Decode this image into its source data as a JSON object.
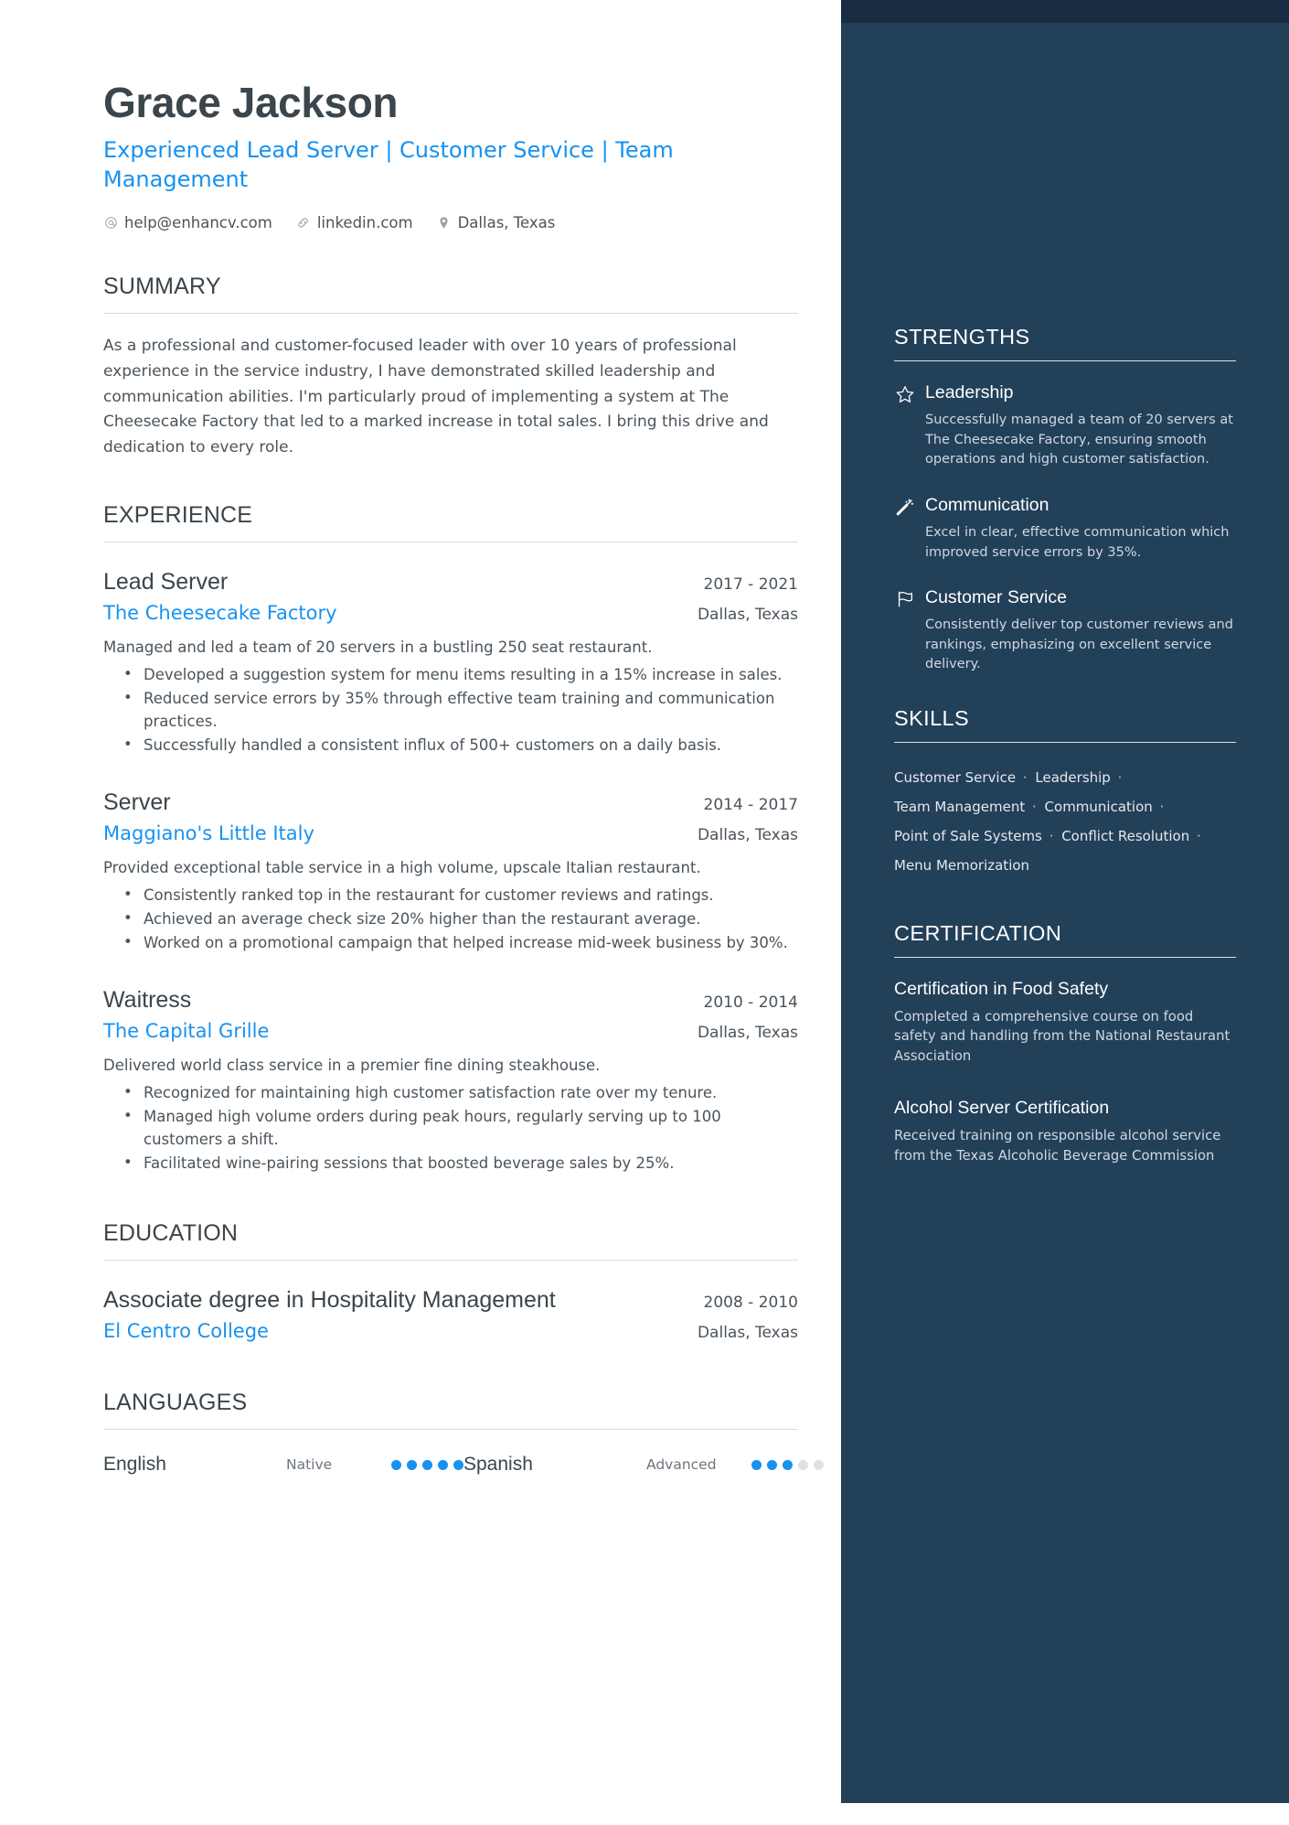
{
  "theme": {
    "accent_blue": "#1792f0",
    "sidebar_bg": "#234059",
    "sidebar_topbar": "#1a2c42",
    "heading_dark": "#3a454c",
    "body_text": "#4a545c",
    "dot_off": "#dfe2e5"
  },
  "header": {
    "name": "Grace Jackson",
    "headline": "Experienced Lead Server | Customer Service | Team Management",
    "contacts": [
      {
        "icon": "at-icon",
        "text": "help@enhancv.com"
      },
      {
        "icon": "link-icon",
        "text": "linkedin.com"
      },
      {
        "icon": "location-pin-icon",
        "text": "Dallas, Texas"
      }
    ]
  },
  "summary": {
    "heading": "SUMMARY",
    "text": "As a professional and customer-focused leader with over 10 years of professional experience in the service industry, I have demonstrated skilled leadership and communication abilities. I'm particularly proud of implementing a system at The Cheesecake Factory that led to a marked increase in total sales. I bring this drive and dedication to every role."
  },
  "experience": {
    "heading": "EXPERIENCE",
    "entries": [
      {
        "role": "Lead Server",
        "organization": "The Cheesecake Factory",
        "date": "2017 - 2021",
        "location": "Dallas, Texas",
        "description": "Managed and led a team of 20 servers in a bustling 250 seat restaurant.",
        "bullets": [
          "Developed a suggestion system for menu items resulting in a 15% increase in sales.",
          "Reduced service errors by 35% through effective team training and communication practices.",
          "Successfully handled a consistent influx of 500+ customers on a daily basis."
        ]
      },
      {
        "role": "Server",
        "organization": "Maggiano's Little Italy",
        "date": "2014 - 2017",
        "location": "Dallas, Texas",
        "description": "Provided exceptional table service in a high volume, upscale Italian restaurant.",
        "bullets": [
          "Consistently ranked top in the restaurant for customer reviews and ratings.",
          "Achieved an average check size 20% higher than the restaurant average.",
          "Worked on a promotional campaign that helped increase mid-week business by 30%."
        ]
      },
      {
        "role": "Waitress",
        "organization": "The Capital Grille",
        "date": "2010 - 2014",
        "location": "Dallas, Texas",
        "description": "Delivered world class service in a premier fine dining steakhouse.",
        "bullets": [
          "Recognized for maintaining high customer satisfaction rate over my tenure.",
          "Managed high volume orders during peak hours, regularly serving up to 100 customers a shift.",
          "Facilitated wine-pairing sessions that boosted beverage sales by 25%."
        ]
      }
    ]
  },
  "education": {
    "heading": "EDUCATION",
    "entries": [
      {
        "degree": "Associate degree in Hospitality Management",
        "school": "El Centro College",
        "date": "2008 - 2010",
        "location": "Dallas, Texas"
      }
    ]
  },
  "languages": {
    "heading": "LANGUAGES",
    "items": [
      {
        "name": "English",
        "level": "Native",
        "filled": 5,
        "total": 5
      },
      {
        "name": "Spanish",
        "level": "Advanced",
        "filled": 3,
        "total": 5
      }
    ]
  },
  "strengths": {
    "heading": "STRENGTHS",
    "items": [
      {
        "icon": "star-icon",
        "title": "Leadership",
        "description": "Successfully managed a team of 20 servers at The Cheesecake Factory, ensuring smooth operations and high customer satisfaction."
      },
      {
        "icon": "magic-wand-icon",
        "title": "Communication",
        "description": "Excel in clear, effective communication which improved service errors by 35%."
      },
      {
        "icon": "flag-icon",
        "title": "Customer Service",
        "description": "Consistently deliver top customer reviews and rankings, emphasizing on excellent service delivery."
      }
    ]
  },
  "skills": {
    "heading": "SKILLS",
    "items": [
      "Customer Service",
      "Leadership",
      "Team Management",
      "Communication",
      "Point of Sale Systems",
      "Conflict Resolution",
      "Menu Memorization"
    ],
    "separator": "·"
  },
  "certification": {
    "heading": "CERTIFICATION",
    "items": [
      {
        "title": "Certification in Food Safety",
        "description": "Completed a comprehensive course on food safety and handling from the National Restaurant Association"
      },
      {
        "title": "Alcohol Server Certification",
        "description": "Received training on responsible alcohol service from the Texas Alcoholic Beverage Commission"
      }
    ]
  }
}
